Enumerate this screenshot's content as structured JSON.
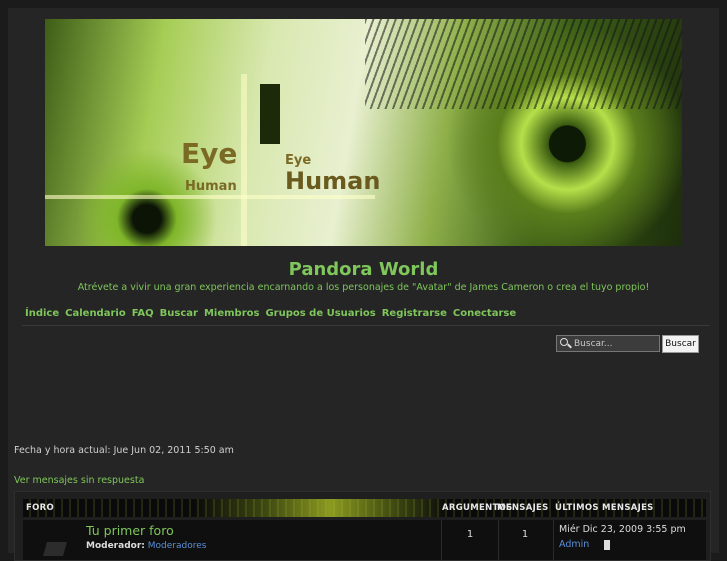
{
  "site": {
    "title": "Pandora World",
    "description": "Atrévete a vivir una gran experiencia encarnando a los personajes de \"Avatar\" de James Cameron o crea el tuyo propio!"
  },
  "banner": {
    "word_eye": "Eye",
    "word_human": "Human"
  },
  "navbar": [
    "Índice",
    "Calendario",
    "FAQ",
    "Buscar",
    "Miembros",
    "Grupos de Usuarios",
    "Registrarse",
    "Conectarse"
  ],
  "search": {
    "placeholder": "Buscar...",
    "button_label": "Buscar"
  },
  "datetime": "Fecha y hora actual: Jue Jun 02, 2011 5:50 am",
  "unanswered_link": "Ver mensajes sin respuesta",
  "forum_table": {
    "headers": {
      "forum": "FORO",
      "topics": "ARGUMENTOS",
      "posts": "MENSAJES",
      "last": "ÚLTIMOS MENSAJES"
    },
    "rows": [
      {
        "title": "Tu primer foro",
        "moderator_label": "Moderador:",
        "moderator": "Moderadores",
        "topics": "1",
        "posts": "1",
        "last_date": "Miér Dic 23, 2009 3:55 pm",
        "last_user": "Admin"
      }
    ]
  },
  "colors": {
    "accent": "#7fc65b",
    "background": "#252525",
    "link_blue": "#5b8fd8"
  }
}
